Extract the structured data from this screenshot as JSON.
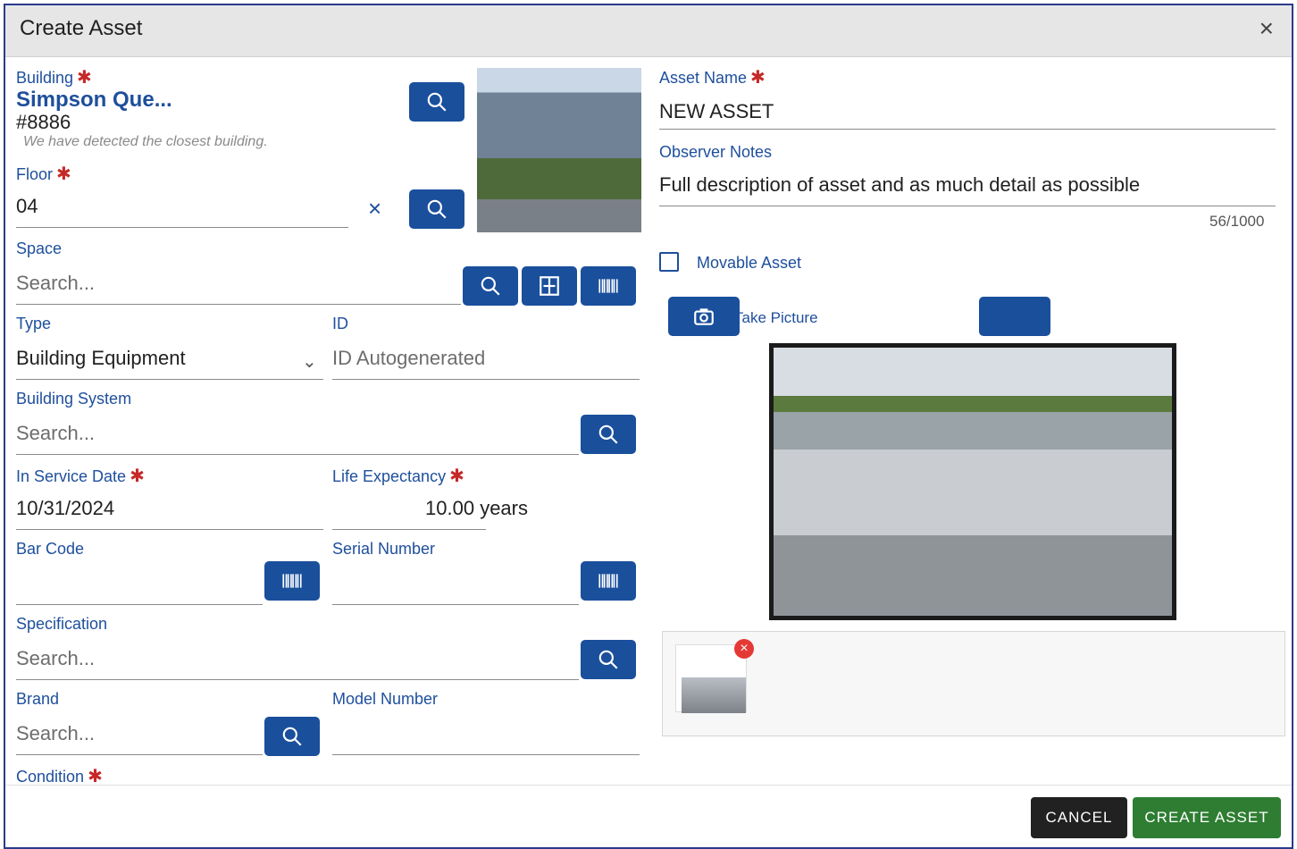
{
  "dialog": {
    "title": "Create Asset",
    "close_glyph": "×"
  },
  "building": {
    "label": "Building",
    "name": "Simpson Que...",
    "number": "#8886",
    "hint": "We have detected the closest building."
  },
  "floor": {
    "label": "Floor",
    "value": "04",
    "clear_glyph": "×"
  },
  "space": {
    "label": "Space",
    "placeholder": "Search..."
  },
  "type": {
    "label": "Type",
    "value": "Building Equipment"
  },
  "id": {
    "label": "ID",
    "placeholder": "ID Autogenerated"
  },
  "building_system": {
    "label": "Building System",
    "placeholder": "Search..."
  },
  "in_service_date": {
    "label": "In Service Date",
    "value": "10/31/2024"
  },
  "life_expectancy": {
    "label": "Life Expectancy",
    "value": "10.00",
    "unit": "years"
  },
  "bar_code": {
    "label": "Bar Code"
  },
  "serial_number": {
    "label": "Serial Number"
  },
  "specification": {
    "label": "Specification",
    "placeholder": "Search..."
  },
  "brand": {
    "label": "Brand",
    "placeholder": "Search..."
  },
  "model_number": {
    "label": "Model Number"
  },
  "condition": {
    "label": "Condition"
  },
  "asset_name": {
    "label": "Asset Name",
    "value": "NEW ASSET"
  },
  "observer_notes": {
    "label": "Observer Notes",
    "value": "Full description of asset and as much detail as possible",
    "counter": "56/1000"
  },
  "movable_asset": {
    "label": "Movable Asset",
    "checked": false
  },
  "photo_buttons": {
    "take_picture": "Take Picture"
  },
  "footer": {
    "cancel": "CANCEL",
    "create": "CREATE ASSET"
  },
  "colors": {
    "primary": "#1a4f9c",
    "label": "#1e4f9c",
    "required": "#c62828",
    "cancel_bg": "#212121",
    "create_bg": "#2e7d32"
  },
  "icons": [
    "close-icon",
    "search-icon",
    "floorplan-icon",
    "barcode-icon",
    "chevron-down-icon",
    "camera-icon",
    "remove-photo-icon"
  ]
}
